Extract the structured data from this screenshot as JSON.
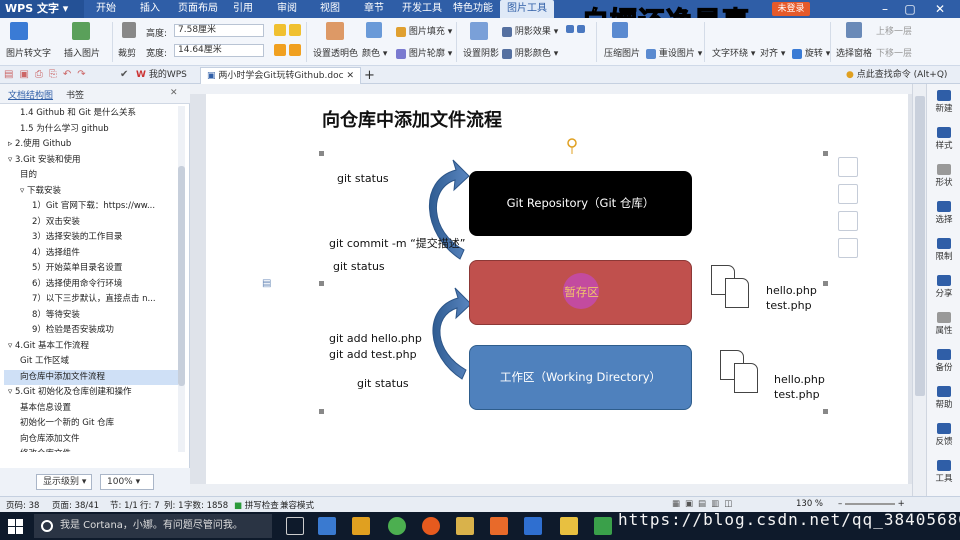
{
  "app": {
    "name": "WPS 文字",
    "login": "未登录",
    "watermark": "白嫖还净是事"
  },
  "menu_tabs": [
    "开始",
    "插入",
    "页面布局",
    "引用",
    "审阅",
    "视图",
    "章节",
    "开发工具",
    "特色功能",
    "图片工具"
  ],
  "ribbon": {
    "pic_to_text": "图片转文字",
    "insert_pic": "插入图片",
    "crop": "裁剪",
    "height_label": "高度:",
    "height_value": "7.58厘米",
    "width_label": "宽度:",
    "width_value": "14.64厘米",
    "transparent": "设置透明色",
    "color": "颜色",
    "fill": "图片填充",
    "outline": "图片轮廓",
    "shadow": "设置阴影",
    "shadow_effect": "阴影效果",
    "shadow_color": "阴影颜色",
    "compress": "压缩图片",
    "reset": "重设图片",
    "wrap": "文字环绕",
    "align": "对齐",
    "rotate": "旋转",
    "select_pane": "选择窗格",
    "up": "上移一层",
    "down": "下移一层"
  },
  "qat": {
    "tab_mywps": "我的WPS",
    "tab_doc": "两小时学会Git玩转Github.doc",
    "find_cmd": "点此查找命令 (Alt+Q)"
  },
  "nav": {
    "tab_toc": "文档结构图",
    "tab_bookmark": "书签",
    "items": [
      {
        "label": "1.4 Github 和 Git 是什么关系",
        "indent": 1,
        "selected": false
      },
      {
        "label": "1.5 为什么学习 github",
        "indent": 1,
        "selected": false
      },
      {
        "label": "▹ 2.使用 Github",
        "indent": 0,
        "selected": false
      },
      {
        "label": "▿ 3.Git 安装和使用",
        "indent": 0,
        "selected": false
      },
      {
        "label": "目的",
        "indent": 1,
        "selected": false
      },
      {
        "label": "▿ 下载安装",
        "indent": 1,
        "selected": false
      },
      {
        "label": "1）Git 官网下载：https://ww...",
        "indent": 2,
        "selected": false
      },
      {
        "label": "2）双击安装",
        "indent": 2,
        "selected": false
      },
      {
        "label": "3）选择安装的工作目录",
        "indent": 2,
        "selected": false
      },
      {
        "label": "4）选择组件",
        "indent": 2,
        "selected": false
      },
      {
        "label": "5）开始菜单目录名设置",
        "indent": 2,
        "selected": false
      },
      {
        "label": "6）选择使用命令行环境",
        "indent": 2,
        "selected": false
      },
      {
        "label": "7）以下三步默认，直接点击 n...",
        "indent": 2,
        "selected": false
      },
      {
        "label": "8）等待安装",
        "indent": 2,
        "selected": false
      },
      {
        "label": "9）检验是否安装成功",
        "indent": 2,
        "selected": false
      },
      {
        "label": "▿ 4.Git 基本工作流程",
        "indent": 0,
        "selected": false
      },
      {
        "label": "Git 工作区域",
        "indent": 1,
        "selected": false
      },
      {
        "label": "向仓库中添加文件流程",
        "indent": 1,
        "selected": true
      },
      {
        "label": "▿ 5.Git 初始化及仓库创建和操作",
        "indent": 0,
        "selected": false
      },
      {
        "label": "基本信息设置",
        "indent": 1,
        "selected": false
      },
      {
        "label": "初始化一个新的 Git 仓库",
        "indent": 1,
        "selected": false
      },
      {
        "label": "向仓库添加文件",
        "indent": 1,
        "selected": false
      },
      {
        "label": "修改仓库文件",
        "indent": 1,
        "selected": false
      }
    ],
    "display_level": "显示级别",
    "zoom": "100%"
  },
  "document": {
    "heading": "向仓库中添加文件流程",
    "cmd1": "git status",
    "cmd2": "git commit -m “提交描述”",
    "cmd3": "git status",
    "cmd4": "git add hello.php",
    "cmd5": "git add test.php",
    "cmd6": "git status",
    "repo": "Git Repository（Git 仓库）",
    "stage": "暂存区",
    "work": "工作区（Working Directory）",
    "files1a": "hello.php",
    "files1b": "test.php",
    "files2a": "hello.php",
    "files2b": "test.php"
  },
  "right_panel": [
    "新建",
    "样式",
    "形状",
    "选择",
    "限制",
    "分享",
    "属性",
    "备份",
    "帮助",
    "反馈",
    "工具"
  ],
  "status": {
    "page": "页码: 38",
    "pages": "页面: 38/41",
    "section": "节: 1/1",
    "row": "行: 7",
    "col": "列: 1",
    "words": "字数: 1858",
    "spell": "拼写检查",
    "mode": "兼容模式",
    "zoom": "130 %"
  },
  "taskbar": {
    "cortana": "我是 Cortana，小娜。有问题尽管问我。"
  },
  "url_watermark": "https://blog.csdn.net/qq_38405680",
  "colors": {
    "repo": "#000000",
    "stage": "#c0504d",
    "work": "#4f81bd",
    "title_bar": "#2f5ea7",
    "arrow": "#4a74a8"
  }
}
